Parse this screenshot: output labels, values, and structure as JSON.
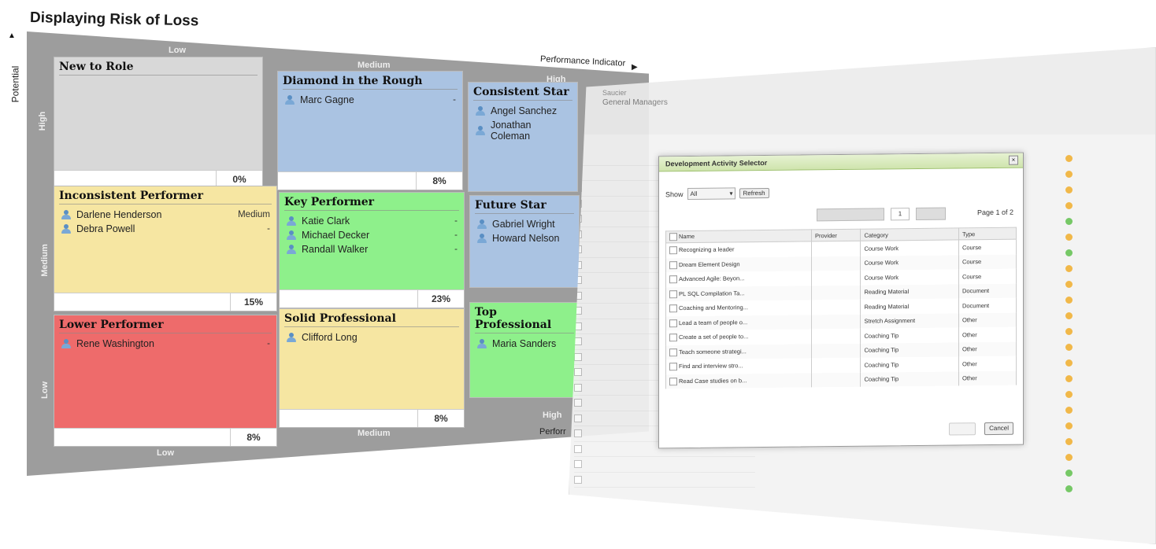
{
  "title": "Displaying Risk of Loss",
  "axes": {
    "potential": "Potential",
    "performance": "Performance Indicator",
    "performance_cut": "Perforr",
    "top": {
      "low": "Low",
      "medium": "Medium",
      "high": "High"
    },
    "bottom": {
      "low": "Low",
      "medium": "Medium",
      "high": "High"
    },
    "left": {
      "high": "High",
      "medium": "Medium",
      "low": "Low"
    }
  },
  "cells": {
    "new_to_role": {
      "title": "New to Role",
      "pct": "0%"
    },
    "diamond": {
      "title": "Diamond in the Rough",
      "pct": "8%",
      "people": [
        {
          "name": "Marc Gagne",
          "risk": "-"
        }
      ]
    },
    "consistent_star": {
      "title": "Consistent Star",
      "people": [
        {
          "name": "Angel Sanchez"
        },
        {
          "name": "Jonathan Coleman"
        }
      ]
    },
    "inconsistent": {
      "title": "Inconsistent Performer",
      "pct": "15%",
      "people": [
        {
          "name": "Darlene Henderson",
          "risk": "Medium"
        },
        {
          "name": "Debra Powell",
          "risk": "-"
        }
      ]
    },
    "key_performer": {
      "title": "Key Performer",
      "pct": "23%",
      "people": [
        {
          "name": "Katie Clark",
          "risk": "-"
        },
        {
          "name": "Michael Decker",
          "risk": "-"
        },
        {
          "name": "Randall Walker",
          "risk": "-"
        }
      ]
    },
    "future_star": {
      "title": "Future Star",
      "people": [
        {
          "name": "Gabriel Wright"
        },
        {
          "name": "Howard Nelson"
        }
      ]
    },
    "lower_performer": {
      "title": "Lower Performer",
      "pct": "8%",
      "people": [
        {
          "name": "Rene Washington",
          "risk": "-"
        }
      ]
    },
    "solid_professional": {
      "title": "Solid Professional",
      "pct": "8%",
      "people": [
        {
          "name": "Clifford Long"
        }
      ]
    },
    "top_professional": {
      "title": "Top Professional",
      "people": [
        {
          "name": "Maria Sanders"
        }
      ]
    }
  },
  "app": {
    "name_line1": "Saucier",
    "name_line2": "General Managers"
  },
  "dialog": {
    "title": "Development Activity Selector",
    "show_label": "Show",
    "show_value": "All",
    "refresh_label": "Refresh",
    "page_value": "1",
    "page_label": "Page 1 of 2",
    "columns": [
      "Name",
      "Provider",
      "Category",
      "Type"
    ],
    "rows": [
      {
        "name": "Recognizing a leader",
        "category": "Course Work",
        "type": "Course"
      },
      {
        "name": "Dream Element Design",
        "category": "Course Work",
        "type": "Course"
      },
      {
        "name": "Advanced Agile: Beyon...",
        "category": "Course Work",
        "type": "Course"
      },
      {
        "name": "PL SQL Compilation Ta...",
        "category": "Reading Material",
        "type": "Document"
      },
      {
        "name": "Coaching and Mentoring...",
        "category": "Reading Material",
        "type": "Document"
      },
      {
        "name": "Lead a team of people o...",
        "category": "Stretch Assignment",
        "type": "Other"
      },
      {
        "name": "Create a set of people to...",
        "category": "Coaching Tip",
        "type": "Other"
      },
      {
        "name": "Teach someone strategi...",
        "category": "Coaching Tip",
        "type": "Other"
      },
      {
        "name": "Find and interview stro...",
        "category": "Coaching Tip",
        "type": "Other"
      },
      {
        "name": "Read Case studies on b...",
        "category": "Coaching Tip",
        "type": "Other"
      }
    ],
    "cancel_label": "Cancel"
  }
}
